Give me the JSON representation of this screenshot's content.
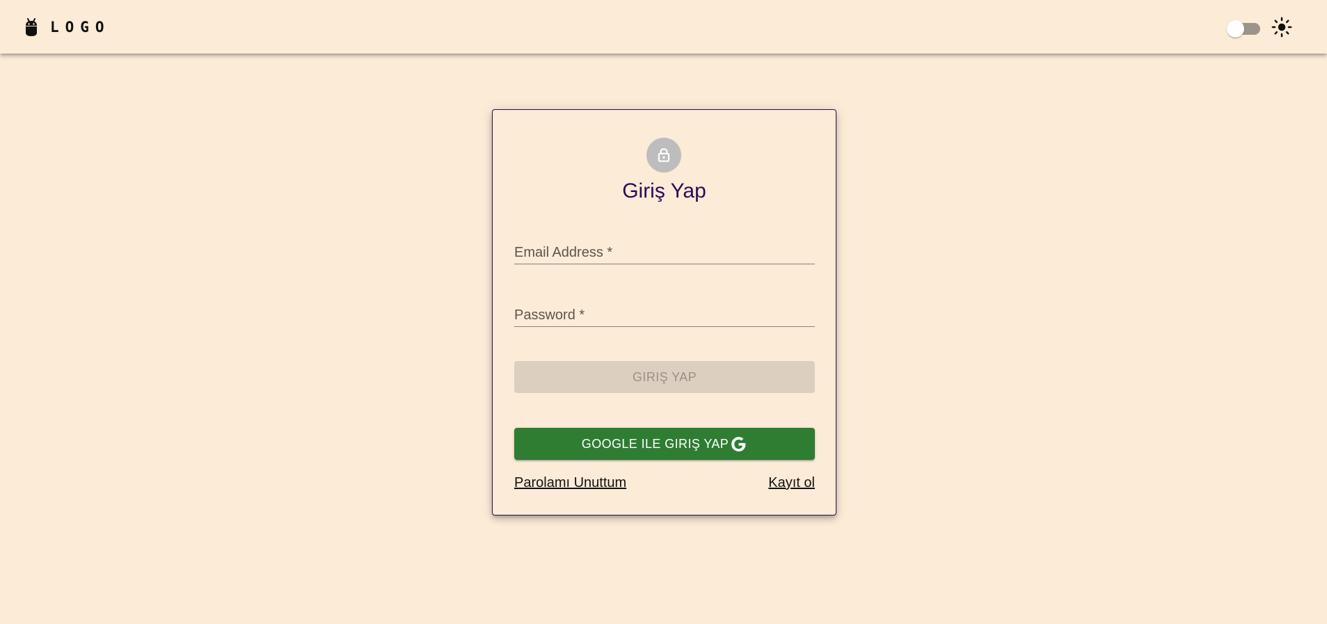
{
  "header": {
    "logo_text": "LOGO",
    "logo_icon": "android-icon",
    "theme_icon": "sun-icon"
  },
  "login": {
    "avatar_icon": "lock-icon",
    "title": "Giriş Yap",
    "email": {
      "label": "Email Address *",
      "value": ""
    },
    "password": {
      "label": "Password *",
      "value": ""
    },
    "submit_label": "GIRIŞ YAP",
    "google_label": "GOOGLE ILE GIRIŞ YAP",
    "google_icon": "google-icon",
    "forgot_label": "Parolamı Unuttum",
    "register_label": "Kayıt ol"
  },
  "colors": {
    "background": "#fbebd7",
    "primary": "#2d0b54",
    "google_button": "#2e7d32",
    "disabled_button": "#ddcfbf",
    "avatar": "#bdbdbd"
  }
}
